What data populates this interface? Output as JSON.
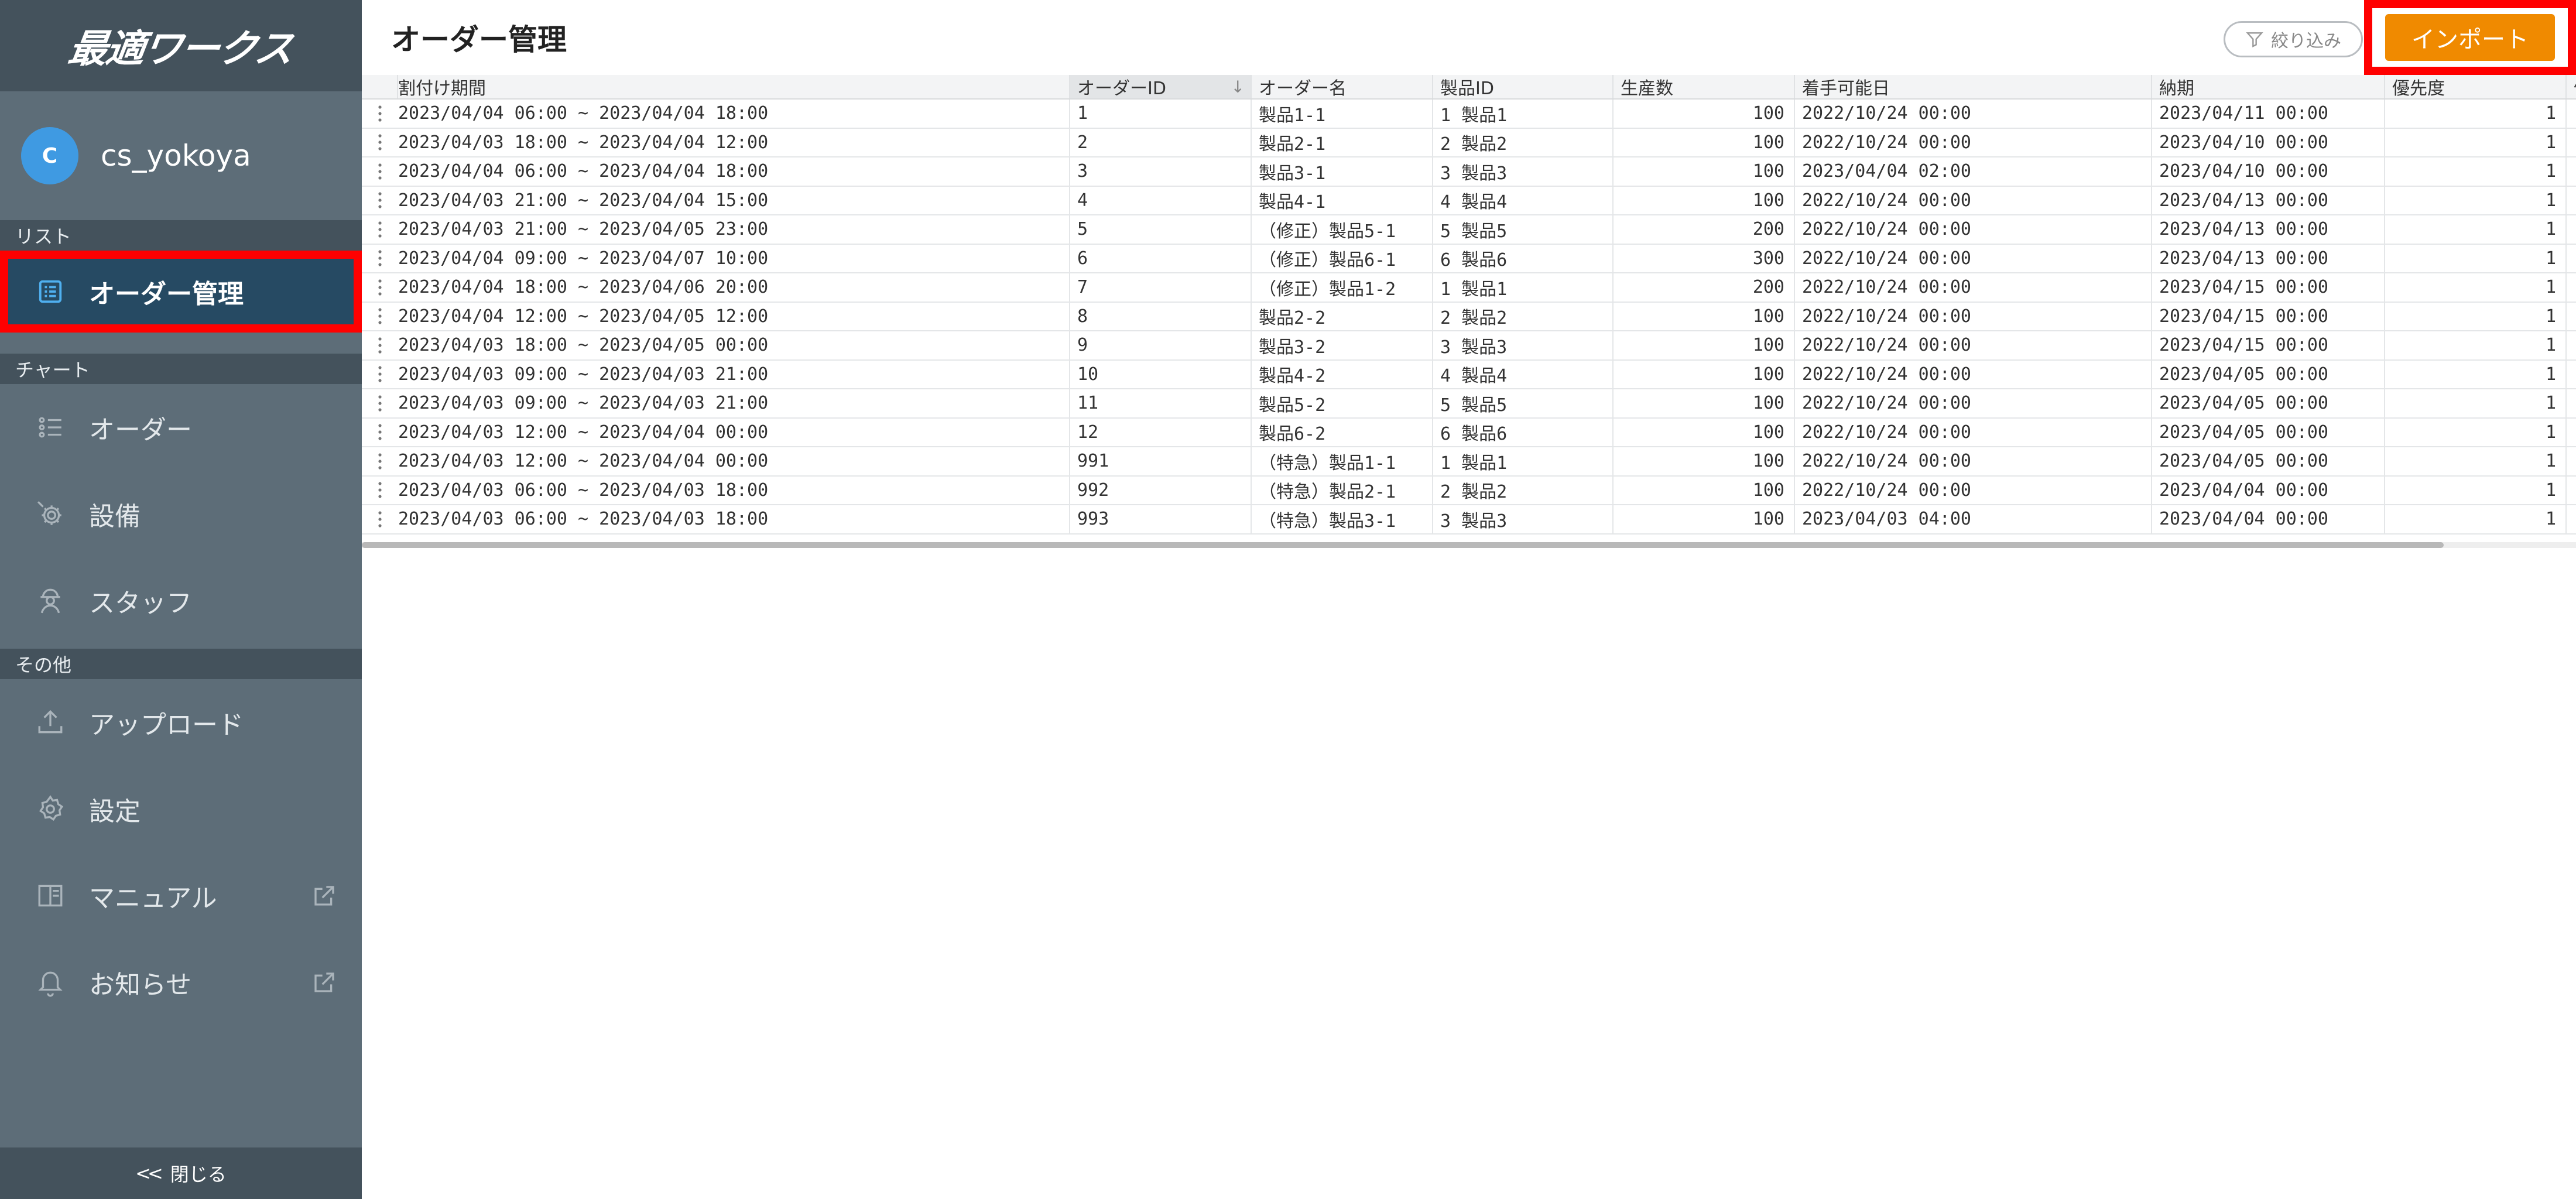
{
  "app": {
    "logo_text": "最適ワークス"
  },
  "user": {
    "initial": "C",
    "name": "cs_yokoya"
  },
  "sidebar": {
    "sections": {
      "list": "リスト",
      "chart": "チャート",
      "other": "その他"
    },
    "items": [
      {
        "label": "オーダー管理",
        "icon": "list-icon"
      },
      {
        "label": "オーダー",
        "icon": "order-list-icon"
      },
      {
        "label": "設備",
        "icon": "gear-icon"
      },
      {
        "label": "スタッフ",
        "icon": "staff-icon"
      },
      {
        "label": "アップロード",
        "icon": "upload-icon"
      },
      {
        "label": "設定",
        "icon": "settings-icon"
      },
      {
        "label": "マニュアル",
        "icon": "book-icon"
      },
      {
        "label": "お知らせ",
        "icon": "bell-icon"
      }
    ],
    "close_label": "閉じる",
    "close_chevrons": "<<"
  },
  "header": {
    "title": "オーダー管理",
    "filter_label": "絞り込み",
    "import_label": "インポート"
  },
  "table": {
    "columns": [
      "割付け期間",
      "オーダーID",
      "オーダー名",
      "製品ID",
      "生産数",
      "着手可能日",
      "納期",
      "優先度",
      "備考"
    ],
    "sort_indicator": "↓",
    "rows": [
      [
        "2023/04/04 06:00 ~ 2023/04/04 18:00",
        "1",
        "製品1-1",
        "1 製品1",
        "100",
        "2022/10/24 00:00",
        "2023/04/11 00:00",
        "1"
      ],
      [
        "2023/04/03 18:00 ~ 2023/04/04 12:00",
        "2",
        "製品2-1",
        "2 製品2",
        "100",
        "2022/10/24 00:00",
        "2023/04/10 00:00",
        "1"
      ],
      [
        "2023/04/04 06:00 ~ 2023/04/04 18:00",
        "3",
        "製品3-1",
        "3 製品3",
        "100",
        "2023/04/04 02:00",
        "2023/04/10 00:00",
        "1"
      ],
      [
        "2023/04/03 21:00 ~ 2023/04/04 15:00",
        "4",
        "製品4-1",
        "4 製品4",
        "100",
        "2022/10/24 00:00",
        "2023/04/13 00:00",
        "1"
      ],
      [
        "2023/04/03 21:00 ~ 2023/04/05 23:00",
        "5",
        "（修正）製品5-1",
        "5 製品5",
        "200",
        "2022/10/24 00:00",
        "2023/04/13 00:00",
        "1"
      ],
      [
        "2023/04/04 09:00 ~ 2023/04/07 10:00",
        "6",
        "（修正）製品6-1",
        "6 製品6",
        "300",
        "2022/10/24 00:00",
        "2023/04/13 00:00",
        "1"
      ],
      [
        "2023/04/04 18:00 ~ 2023/04/06 20:00",
        "7",
        "（修正）製品1-2",
        "1 製品1",
        "200",
        "2022/10/24 00:00",
        "2023/04/15 00:00",
        "1"
      ],
      [
        "2023/04/04 12:00 ~ 2023/04/05 12:00",
        "8",
        "製品2-2",
        "2 製品2",
        "100",
        "2022/10/24 00:00",
        "2023/04/15 00:00",
        "1"
      ],
      [
        "2023/04/03 18:00 ~ 2023/04/05 00:00",
        "9",
        "製品3-2",
        "3 製品3",
        "100",
        "2022/10/24 00:00",
        "2023/04/15 00:00",
        "1"
      ],
      [
        "2023/04/03 09:00 ~ 2023/04/03 21:00",
        "10",
        "製品4-2",
        "4 製品4",
        "100",
        "2022/10/24 00:00",
        "2023/04/05 00:00",
        "1"
      ],
      [
        "2023/04/03 09:00 ~ 2023/04/03 21:00",
        "11",
        "製品5-2",
        "5 製品5",
        "100",
        "2022/10/24 00:00",
        "2023/04/05 00:00",
        "1"
      ],
      [
        "2023/04/03 12:00 ~ 2023/04/04 00:00",
        "12",
        "製品6-2",
        "6 製品6",
        "100",
        "2022/10/24 00:00",
        "2023/04/05 00:00",
        "1"
      ],
      [
        "2023/04/03 12:00 ~ 2023/04/04 00:00",
        "991",
        "（特急）製品1-1",
        "1 製品1",
        "100",
        "2022/10/24 00:00",
        "2023/04/05 00:00",
        "1"
      ],
      [
        "2023/04/03 06:00 ~ 2023/04/03 18:00",
        "992",
        "（特急）製品2-1",
        "2 製品2",
        "100",
        "2022/10/24 00:00",
        "2023/04/04 00:00",
        "1"
      ],
      [
        "2023/04/03 06:00 ~ 2023/04/03 18:00",
        "993",
        "（特急）製品3-1",
        "3 製品3",
        "100",
        "2023/04/03 04:00",
        "2023/04/04 00:00",
        "1"
      ]
    ]
  },
  "colors": {
    "sidebar_bg": "#5d6d78",
    "sidebar_header_bg": "#44525c",
    "active_item_bg": "#264a63",
    "accent_orange": "#f08a00",
    "highlight_red": "#ff0000",
    "avatar_blue": "#3f9ae2"
  }
}
